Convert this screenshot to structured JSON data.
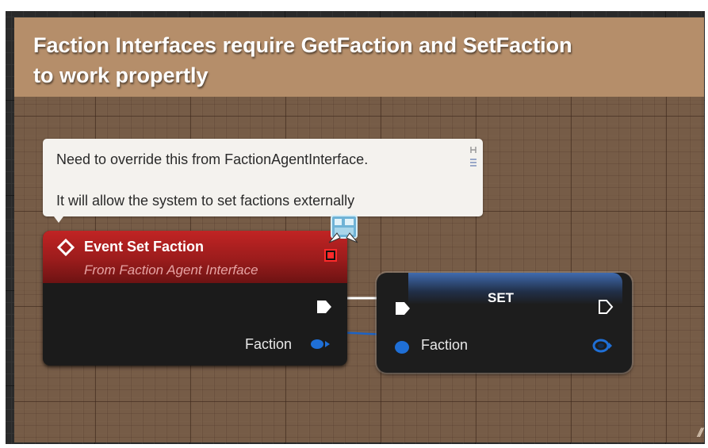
{
  "comment": {
    "title": "Faction Interfaces require GetFaction and SetFaction to work propertly"
  },
  "tooltip": {
    "line1": "Need to override this from FactionAgentInterface.",
    "line2": "It will allow the system to set factions externally"
  },
  "event_node": {
    "title": "Event Set Faction",
    "subtitle": "From Faction Agent Interface",
    "faction_label": "Faction"
  },
  "set_node": {
    "title": "SET",
    "faction_label": "Faction"
  },
  "colors": {
    "event_header": "#b01f1f",
    "variable_pin": "#1f6fd6",
    "exec_pin": "#ffffff",
    "comment_header": "#b58e6a",
    "comment_body": "#88684e"
  },
  "icons": {
    "event": "diamond-icon",
    "delegate": "delegate-pin-icon",
    "interface": "interface-icon",
    "pin": "pin-icon",
    "resize": "resize-grip-icon"
  }
}
